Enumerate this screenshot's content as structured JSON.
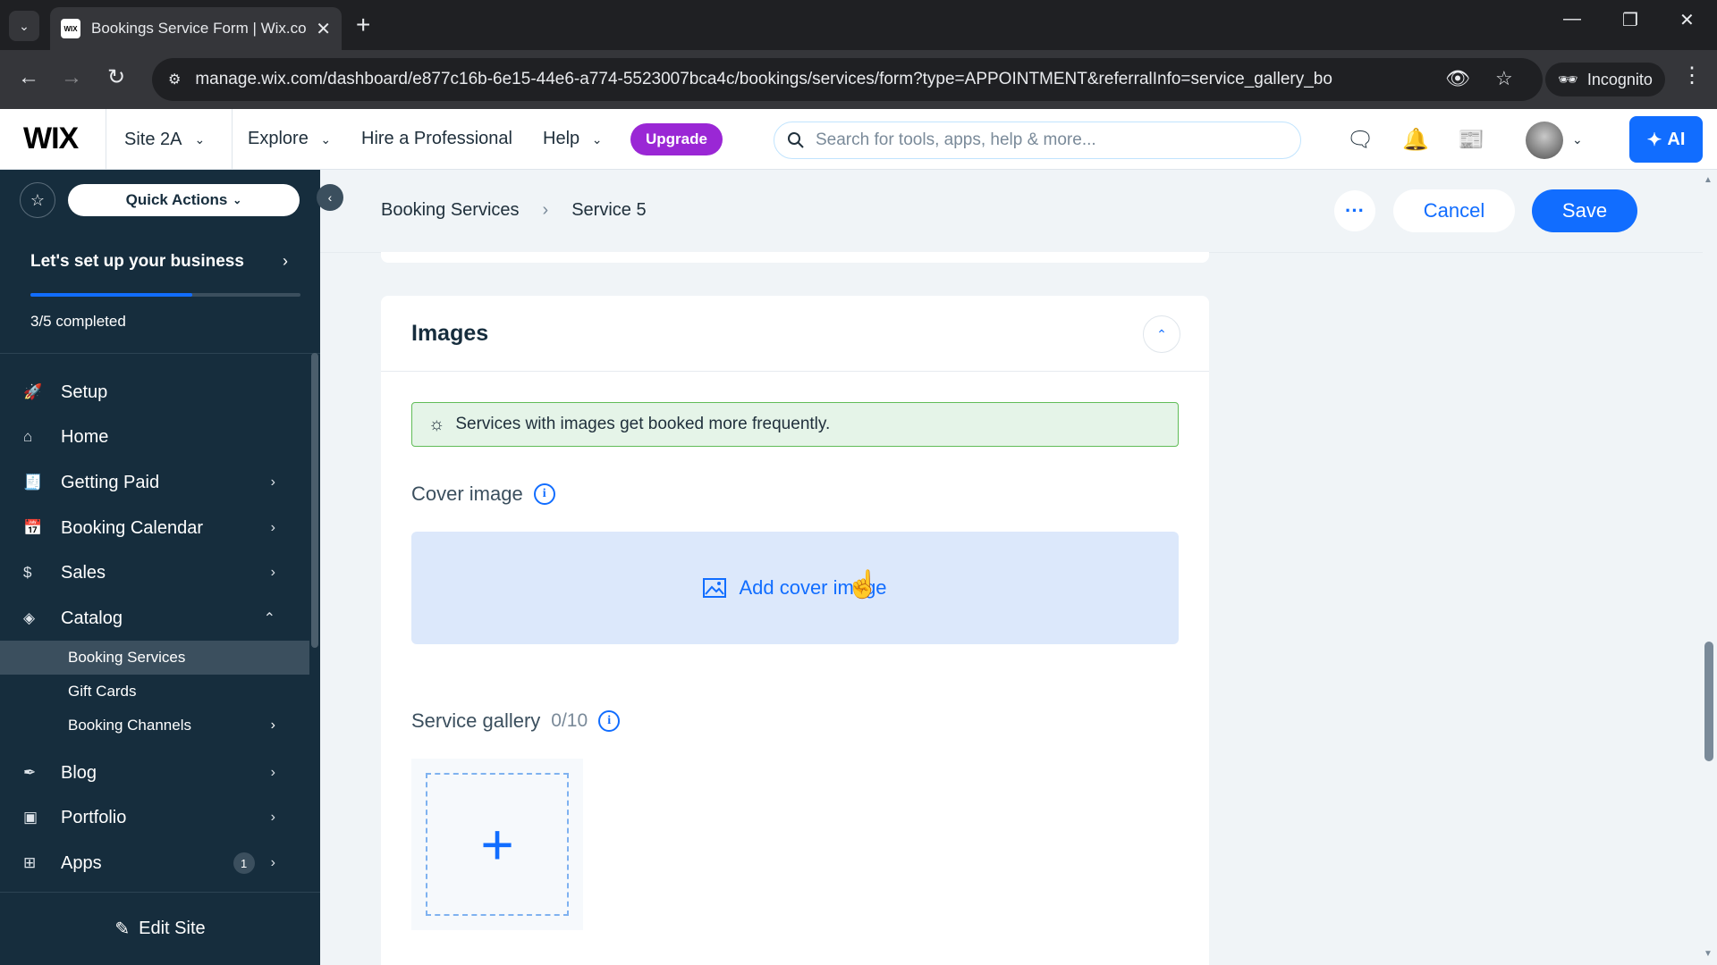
{
  "browser": {
    "tab_title": "Bookings Service Form | Wix.co",
    "favicon_text": "WIX",
    "url": "manage.wix.com/dashboard/e877c16b-6e15-44e6-a774-5523007bca4c/bookings/services/form?type=APPOINTMENT&referralInfo=service_gallery_bo",
    "incognito_label": "Incognito"
  },
  "topbar": {
    "logo": "WIX",
    "site_name": "Site 2A",
    "explore": "Explore",
    "hire": "Hire a Professional",
    "help": "Help",
    "upgrade": "Upgrade",
    "search_placeholder": "Search for tools, apps, help & more...",
    "ai_label": "AI"
  },
  "sidebar": {
    "quick_actions": "Quick Actions",
    "setup_title": "Let's set up your business",
    "setup_progress": 0.6,
    "setup_count": "3/5 completed",
    "items": [
      {
        "label": "Setup"
      },
      {
        "label": "Home"
      },
      {
        "label": "Getting Paid"
      },
      {
        "label": "Booking Calendar"
      },
      {
        "label": "Sales"
      },
      {
        "label": "Catalog"
      }
    ],
    "catalog_sub": [
      {
        "label": "Booking Services"
      },
      {
        "label": "Gift Cards"
      },
      {
        "label": "Booking Channels"
      }
    ],
    "lower_items": [
      {
        "label": "Blog"
      },
      {
        "label": "Portfolio"
      },
      {
        "label": "Apps",
        "badge": "1"
      }
    ],
    "edit_site": "Edit Site"
  },
  "header": {
    "breadcrumb_parent": "Booking Services",
    "breadcrumb_current": "Service 5",
    "cancel": "Cancel",
    "save": "Save"
  },
  "images_card": {
    "title": "Images",
    "tip": "Services with images get booked more frequently.",
    "cover_label": "Cover image",
    "cover_button": "Add cover image",
    "gallery_label": "Service gallery",
    "gallery_count": "0/10"
  },
  "colors": {
    "accent": "#116dff",
    "sidebar_bg": "#162d3d",
    "upgrade": "#9a27d5",
    "tip_bg": "#e5f4e8"
  }
}
